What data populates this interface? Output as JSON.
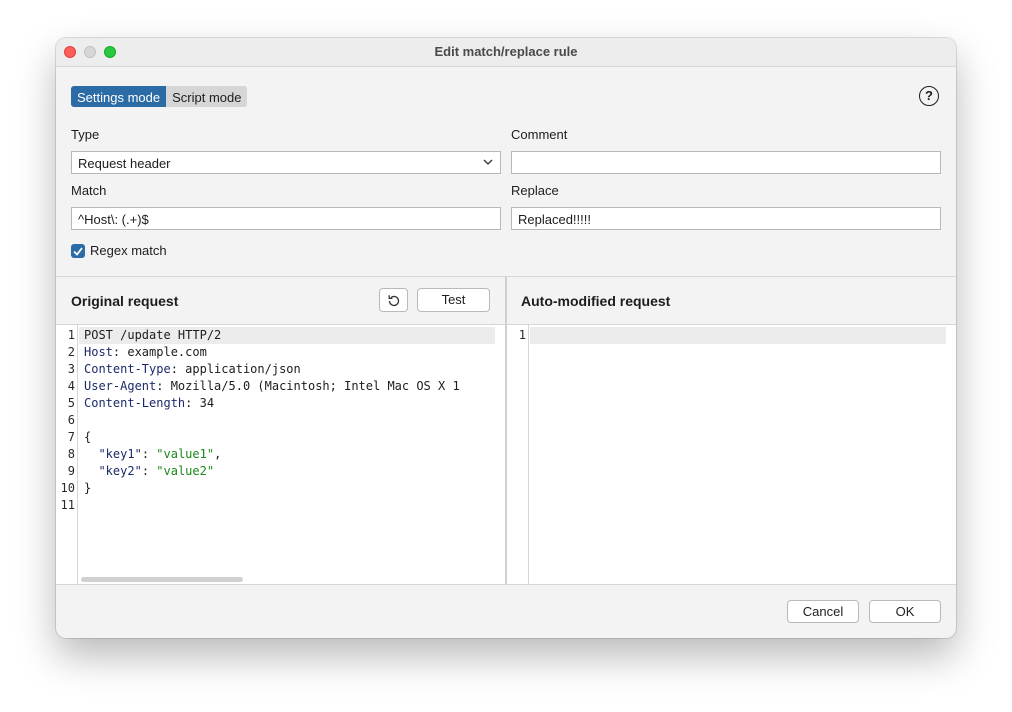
{
  "window": {
    "title": "Edit match/replace rule"
  },
  "mode": {
    "settings_label": "Settings mode",
    "script_label": "Script mode",
    "active": "settings"
  },
  "form": {
    "type_label": "Type",
    "type_value": "Request header",
    "comment_label": "Comment",
    "comment_value": "",
    "match_label": "Match",
    "match_value": "^Host\\: (.+)$",
    "replace_label": "Replace",
    "replace_value": "Replaced!!!!!",
    "regex_label": "Regex match",
    "regex_checked": true
  },
  "original": {
    "title": "Original request",
    "test_label": "Test",
    "lines": [
      {
        "no": "1",
        "name": "",
        "rest": "POST /update HTTP/2"
      },
      {
        "no": "2",
        "name": "Host",
        "rest": ": example.com"
      },
      {
        "no": "3",
        "name": "Content-Type",
        "rest": ": application/json"
      },
      {
        "no": "4",
        "name": "User-Agent",
        "rest": ": Mozilla/5.0 (Macintosh; Intel Mac OS X 1"
      },
      {
        "no": "5",
        "name": "Content-Length",
        "rest": ": 34"
      },
      {
        "no": "6",
        "name": "",
        "rest": ""
      },
      {
        "no": "7",
        "name": "",
        "rest": "{"
      },
      {
        "no": "8",
        "key": "\"key1\"",
        "sep": ": ",
        "val": "\"value1\"",
        "tail": ","
      },
      {
        "no": "9",
        "key": "\"key2\"",
        "sep": ": ",
        "val": "\"value2\"",
        "tail": ""
      },
      {
        "no": "10",
        "name": "",
        "rest": "}"
      },
      {
        "no": "11",
        "name": "",
        "rest": ""
      }
    ]
  },
  "modified": {
    "title": "Auto-modified request",
    "lines": [
      {
        "no": "1"
      }
    ]
  },
  "footer": {
    "cancel_label": "Cancel",
    "ok_label": "OK"
  },
  "colors": {
    "accent": "#2b6ca6",
    "header_name": "#1c2a6b",
    "json_string": "#1a8a1a"
  }
}
